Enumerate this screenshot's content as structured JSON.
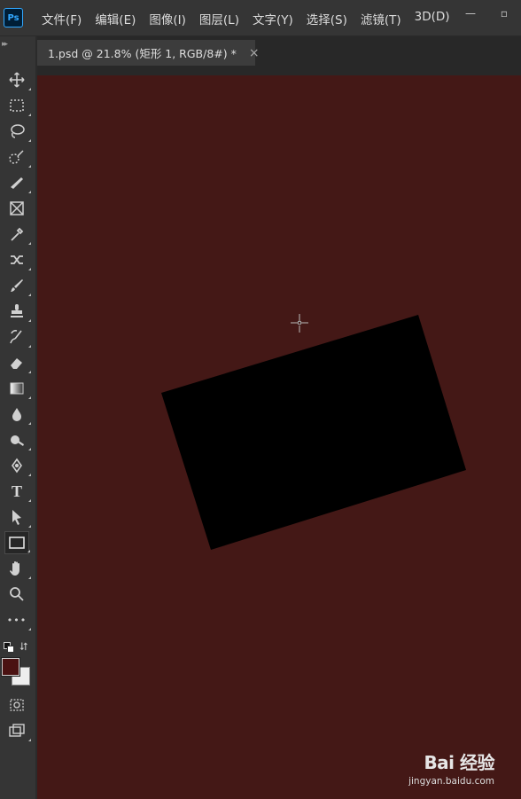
{
  "app": {
    "logo_text": "Ps"
  },
  "menu": [
    "文件(F)",
    "编辑(E)",
    "图像(I)",
    "图层(L)",
    "文字(Y)",
    "选择(S)",
    "滤镜(T)",
    "3D(D)"
  ],
  "window_controls": {
    "minimize": "—",
    "restore": "▫"
  },
  "document_tab": {
    "title": "1.psd @ 21.8% (矩形 1, RGB/8#) *",
    "close": "×"
  },
  "toolbar": {
    "collapse": "▸▸",
    "tools": [
      "move-tool",
      "marquee-tool",
      "lasso-tool",
      "quick-select-tool",
      "crop-tool",
      "frame-tool",
      "eyedropper-tool",
      "healing-tool",
      "brush-tool",
      "clone-stamp-tool",
      "history-brush-tool",
      "eraser-tool",
      "gradient-tool",
      "blur-tool",
      "dodge-tool",
      "pen-tool",
      "type-tool",
      "path-select-tool",
      "rectangle-tool",
      "hand-tool",
      "zoom-tool",
      "more-tools"
    ],
    "active_tool": "rectangle-tool",
    "type_tool_glyph": "T",
    "more_glyph": "•••"
  },
  "colors": {
    "foreground": "#4a1212",
    "background": "#eeeeee",
    "canvas": "#441816",
    "shape": "#000000"
  },
  "watermark": {
    "brand": "Bai 经验",
    "url": "jingyan.baidu.com"
  }
}
